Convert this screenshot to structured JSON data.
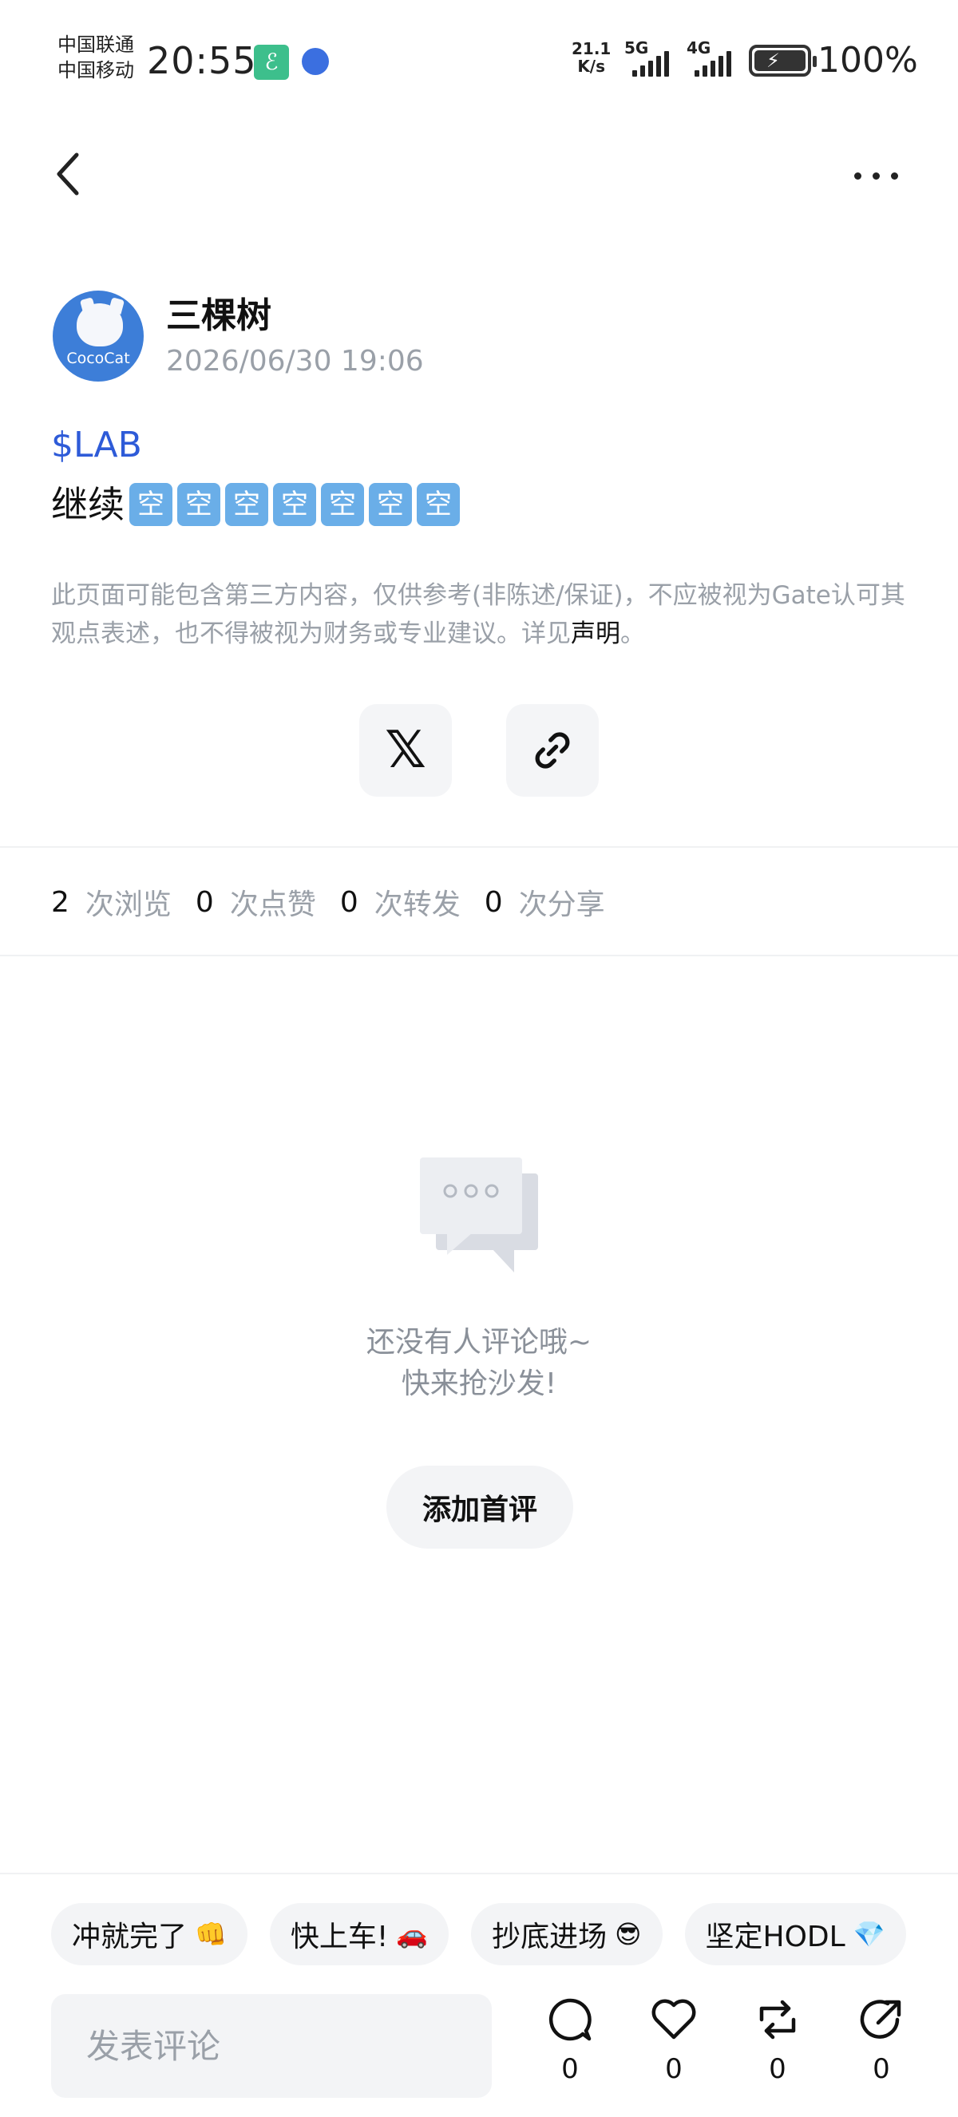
{
  "status_bar": {
    "carrier_1": "中国联通",
    "carrier_2": "中国移动",
    "time": "20:55",
    "net_speed_value": "21.1",
    "net_speed_unit": "K/s",
    "network_1": "5G",
    "network_2": "4G",
    "battery": "100%"
  },
  "nav": {
    "back_icon": "chevron-left-icon",
    "more_icon": "more-horizontal-icon"
  },
  "author": {
    "avatar_label": "CocoCat",
    "name": "三棵树",
    "post_time": "2026/06/30 19:06"
  },
  "post": {
    "ticker": "$LAB",
    "text": "继续",
    "emoji_char": "空",
    "emoji_count": 7
  },
  "disclaimer": {
    "text": "此页面可能包含第三方内容，仅供参考(非陈述/保证)，不应被视为Gate认可其观点表述，也不得被视为财务或专业建议。详见",
    "link": "声明",
    "end": "。"
  },
  "share": {
    "x_glyph": "𝕏",
    "x_icon": "x-logo-icon",
    "link_icon": "link-icon"
  },
  "stats": {
    "views": "2",
    "views_label": "次浏览",
    "likes": "0",
    "likes_label": "次点赞",
    "reposts": "0",
    "reposts_label": "次转发",
    "shares": "0",
    "shares_label": "次分享"
  },
  "empty_state": {
    "illustration": "chat-bubbles-icon",
    "line_1": "还没有人评论哦~",
    "line_2": "快来抢沙发!",
    "button": "添加首评"
  },
  "quick_replies": [
    {
      "text": "冲就完了",
      "emoji": "👊"
    },
    {
      "text": "快上车!",
      "emoji": "🚗"
    },
    {
      "text": "抄底进场",
      "emoji": "😎"
    },
    {
      "text": "坚定HODL",
      "emoji": "💎"
    }
  ],
  "bottom_bar": {
    "input_placeholder": "发表评论",
    "comment_count": "0",
    "like_count": "0",
    "repost_count": "0",
    "share_count": "0"
  },
  "colors": {
    "accent_blue": "#2e5bd8",
    "muted_text": "#9aa0a8",
    "chip_bg": "#f3f4f6"
  }
}
